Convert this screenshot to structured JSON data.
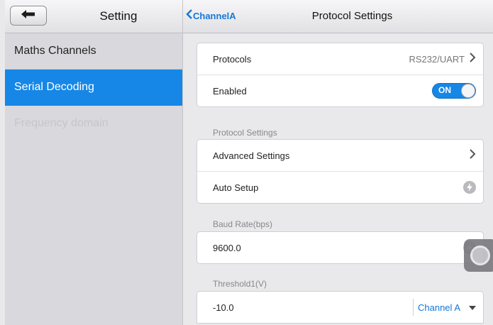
{
  "sidebar": {
    "title": "Setting",
    "items": [
      {
        "label": "Maths Channels",
        "state": "normal"
      },
      {
        "label": "Serial Decoding",
        "state": "active"
      },
      {
        "label": "Frequency domain",
        "state": "disabled"
      }
    ]
  },
  "header": {
    "back_label": "ChannelA",
    "title": "Protocol Settings"
  },
  "protocols": {
    "label": "Protocols",
    "value": "RS232/UART"
  },
  "enabled": {
    "label": "Enabled",
    "toggle": "ON"
  },
  "protocol_settings": {
    "section": "Protocol Settings",
    "advanced": "Advanced Settings",
    "auto_setup": "Auto Setup"
  },
  "baud": {
    "section": "Baud Rate(bps)",
    "value": "9600.0"
  },
  "threshold": {
    "section": "Threshold1(V)",
    "value": "-10.0",
    "channel": "Channel A"
  },
  "colors": {
    "accent": "#1687e6",
    "link": "#1677d6"
  }
}
